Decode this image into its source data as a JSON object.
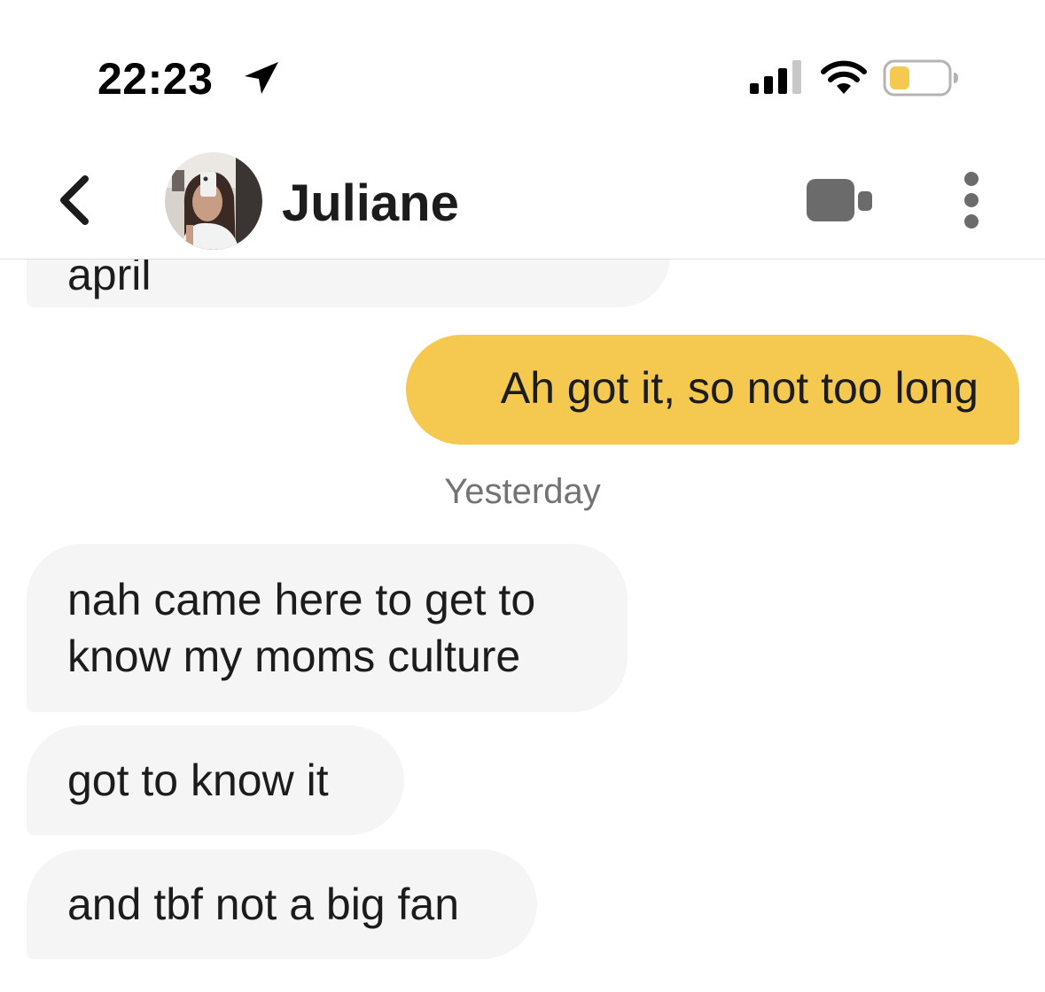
{
  "status_bar": {
    "time": "22:23",
    "location_icon": "location-arrow-icon",
    "signal_icon": "cellular-signal-icon",
    "wifi_icon": "wifi-icon",
    "battery_icon": "battery-icon",
    "battery_level": 0.35,
    "battery_color": "#f5c84f"
  },
  "header": {
    "back_icon": "chevron-left-icon",
    "contact_name": "Juliane",
    "video_icon": "video-camera-icon",
    "more_icon": "more-vertical-icon"
  },
  "messages": [
    {
      "direction": "incoming",
      "text": "april",
      "partially_visible": true
    },
    {
      "direction": "outgoing",
      "text": "Ah got it, so not too long"
    },
    {
      "type": "date_separator",
      "text": "Yesterday"
    },
    {
      "direction": "incoming",
      "text": "nah came here to get to\nknow my moms culture"
    },
    {
      "direction": "incoming",
      "text": "got to know it"
    },
    {
      "direction": "incoming",
      "text": "and tbf not a big fan"
    }
  ],
  "colors": {
    "outgoing_bubble": "#f5c84f",
    "incoming_bubble": "#f5f5f5",
    "icon_gray": "#6b6b6b"
  }
}
